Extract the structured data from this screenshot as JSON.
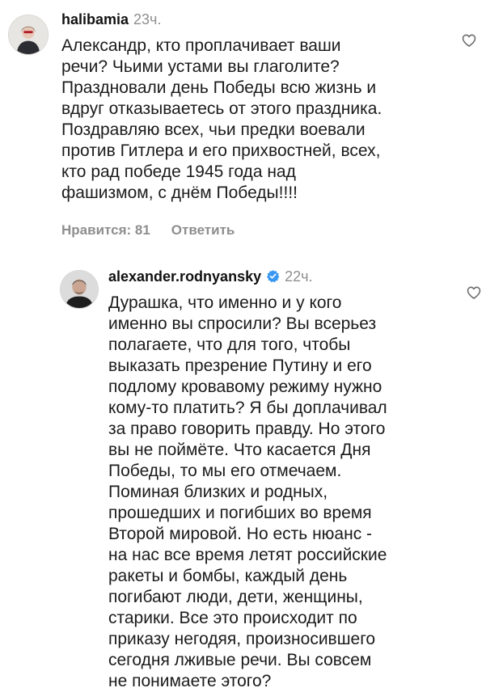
{
  "comments": [
    {
      "username": "halibamia",
      "time": "23ч.",
      "text": "Александр, кто проплачивает ваши\nречи? Чьими устами вы глаголите?\nПраздновали день Победы всю жизнь и\nвдруг отказываетесь от этого праздника.\nПоздравляю всех, чьи предки воевали\nпротив Гитлера и его прихвостней, всех,\nкто рад победе 1945 года над\nфашизмом, с днём Победы!!!!",
      "likes_label": "Нравится: 81",
      "reply_label": "Ответить",
      "like_icon": "heart-outline-icon"
    },
    {
      "username": "alexander.rodnyansky",
      "verified": true,
      "time": "22ч.",
      "text": "Дурашка, что именно и у кого\nименно вы спросили? Вы всерьез\nполагаете, что для того, чтобы\nвыказать презрение Путину и его\nподлому кровавому режиму нужно\nкому-то платить? Я бы доплачивал\nза право говорить правду.  Но этого\nвы не поймёте. Что касается Дня\nПобеды, то мы его отмечаем.\nПоминая близких и родных,\nпрошедших и погибших во время\nВторой мировой.  Но есть нюанс -\nна нас все время летят российские\nракеты и бомбы, каждый день\nпогибают люди, дети, женщины,\nстарики. Все  это происходит по\nприказу негодяя, произносившего\nсегодня лживые речи. Вы совсем\nне понимаете этого?",
      "like_icon": "heart-outline-icon"
    }
  ],
  "colors": {
    "text": "#111111",
    "muted": "#8e8e8e",
    "verified": "#3897f0"
  }
}
